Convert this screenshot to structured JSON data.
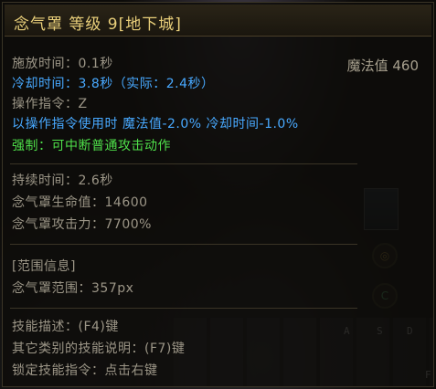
{
  "title": "念气罩 等级 9[地下城]",
  "mana": "魔法值 460",
  "cast_time": "施放时间：0.1秒",
  "cooldown": "冷却时间：3.8秒（实际：2.4秒）",
  "command": "操作指令：Z",
  "command_bonus": "以操作指令使用时 魔法值-2.0% 冷却时间-1.0%",
  "force": "强制：可中断普通攻击动作",
  "duration": "持续时间：2.6秒",
  "hp": "念气罩生命值：14600",
  "atk": "念气罩攻击力：7700%",
  "range_header": "[范围信息]",
  "range": "念气罩范围：357px",
  "desc": "技能描述：(F4)键",
  "other_desc": "其它类别的技能说明：(F7)键",
  "lock": "锁定技能指令：点击右键",
  "hotkeys": [
    "A",
    "S",
    "D",
    "F"
  ],
  "colors": {
    "title": "#e9cf7a",
    "blue": "#48a9ff",
    "green": "#4fe04a",
    "gray": "#9c9687"
  }
}
